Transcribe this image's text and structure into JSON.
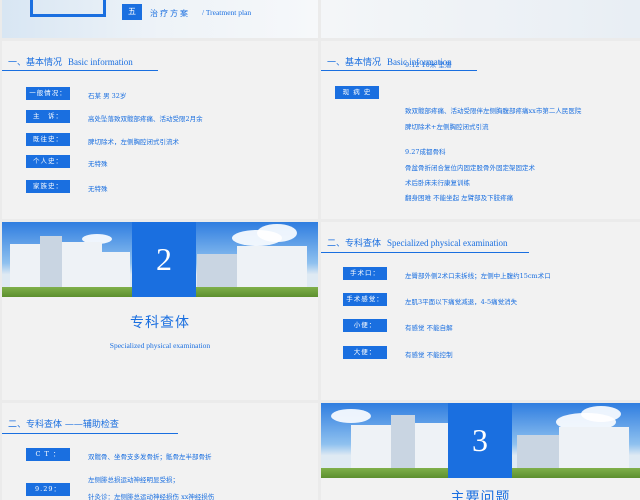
{
  "top_banner": {
    "number": "五",
    "title_cn": "治疗方案",
    "title_en": "/ Treatment plan"
  },
  "slide1": {
    "heading_cn": "一、基本情况",
    "heading_en": "Basic information",
    "rows": [
      {
        "label": "一般情况：",
        "value": "石某 男 32岁"
      },
      {
        "label": "主　诉：",
        "value": "高处坠落致双髋部疼痛、活动受限2月余"
      },
      {
        "label": "既往史：",
        "value": "脾切除术，左侧胸腔闭式引流术"
      },
      {
        "label": "个人史：",
        "value": "无特殊"
      },
      {
        "label": "家族史：",
        "value": "无特殊"
      }
    ]
  },
  "slide2": {
    "heading_cn": "一、基本情况",
    "heading_en": "Basic information",
    "tag": "现 病 史",
    "lines": [
      "9.12 10米 坠落",
      "致双髋部疼痛、活动受限伴左侧胸腹部疼痛xx市第二人民医院",
      "脾切除术+左侧胸腔闭式引流",
      "9.27成都骨科",
      "骨盆骨折闭合复位内固定股骨外固定架固定术",
      "术后卧床未行康复训练",
      "翻身困难 不能坐起 左臂部及下肢疼痛"
    ]
  },
  "slide3": {
    "number": "2",
    "title_cn": "专科查体",
    "title_en": "Specialized physical examination"
  },
  "slide4": {
    "heading_cn": "二、专科查体",
    "heading_en": "Specialized physical examination",
    "rows": [
      {
        "label": "手术口：",
        "value": "左臀部外侧2术口未拆线；左侧中上腹约15cm术口"
      },
      {
        "label": "手术感觉：",
        "value": "左肌3平面以下痛觉减退，4-5痛觉消失"
      },
      {
        "label": "小便：",
        "value": "有感觉 不能自解"
      },
      {
        "label": "大便：",
        "value": "有感觉 不能控制"
      }
    ]
  },
  "slide5": {
    "heading_cn": "二、专科查体 ——辅助检查",
    "rows": [
      {
        "label": "C T ：",
        "value": "双髋骨、坐骨支多发骨折；骶骨左半部骨折"
      },
      {
        "label": "9.29：",
        "value": "左侧腓总损运动神经明显受损；"
      }
    ],
    "extra_line": "针灸诊：左侧腓总运动神经损伤 xx神经损伤"
  },
  "slide6": {
    "number": "3",
    "title_cn": "主要问题"
  }
}
